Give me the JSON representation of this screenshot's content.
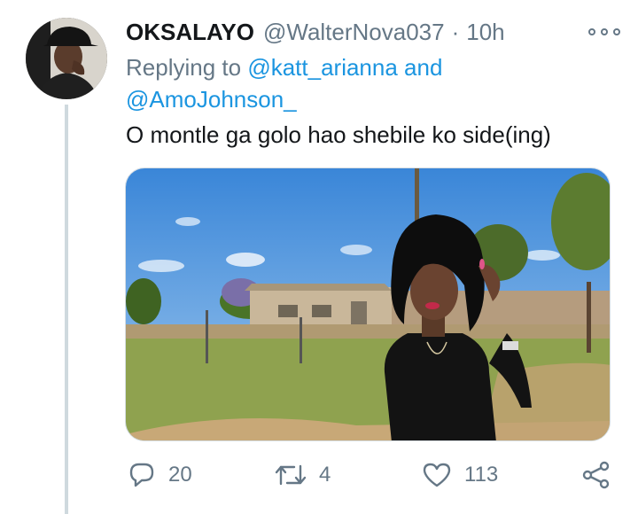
{
  "tweet": {
    "display_name": "OKSALAYO",
    "handle": "@WalterNova037",
    "separator": "·",
    "time": "10h",
    "reply_prefix": "Replying to",
    "reply_mention_1": "@katt_arianna",
    "reply_and": "and",
    "reply_mention_2": "@AmoJohnson_",
    "text": "O montle ga golo hao shebile ko side(ing)"
  },
  "actions": {
    "replies": "20",
    "retweets": "4",
    "likes": "113"
  },
  "icons": {
    "more": "more-horizontal-icon",
    "reply": "reply-icon",
    "retweet": "retweet-icon",
    "like": "heart-icon",
    "share": "share-icon"
  },
  "colors": {
    "mention": "#1b95e0",
    "secondary_text": "#657786",
    "thread_line": "#cfd9de"
  }
}
